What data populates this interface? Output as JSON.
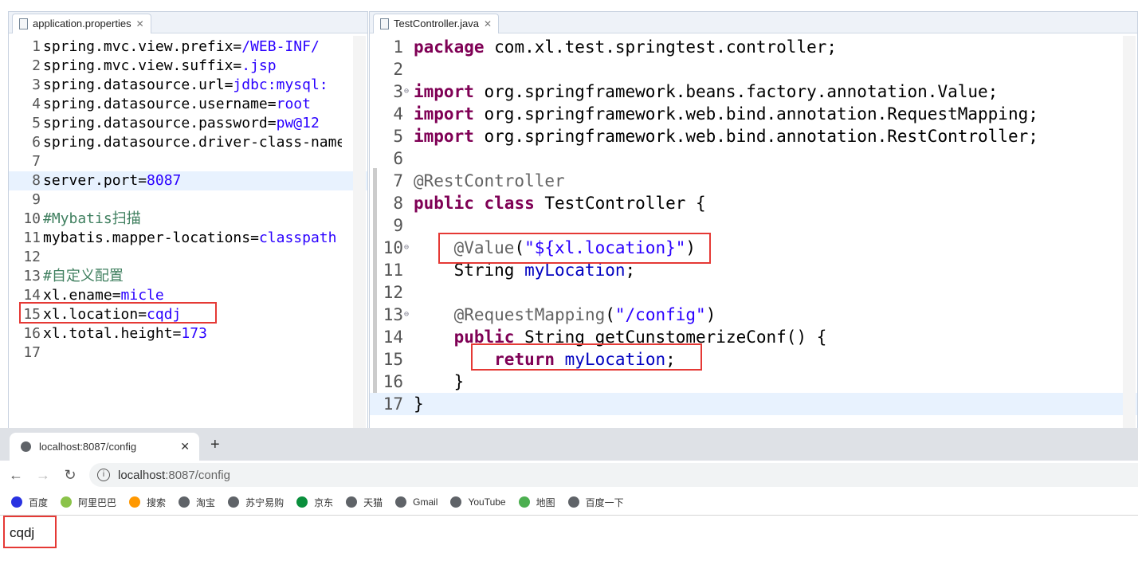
{
  "left_editor": {
    "tab": "application.properties",
    "lines": [
      [
        [
          "spring.mvc.view.prefix=",
          ""
        ],
        [
          "/WEB-INF/",
          "v"
        ]
      ],
      [
        [
          "spring.mvc.view.suffix=",
          ""
        ],
        [
          ".jsp",
          "v"
        ]
      ],
      [
        [
          "spring.datasource.url=",
          ""
        ],
        [
          "jdbc:mysql:",
          "v"
        ]
      ],
      [
        [
          "spring.datasource.username=",
          ""
        ],
        [
          "root",
          "v"
        ]
      ],
      [
        [
          "spring.datasource.password=",
          ""
        ],
        [
          "pw@12",
          "v"
        ]
      ],
      [
        [
          "spring.datasource.driver-class-name",
          ""
        ]
      ],
      [],
      [
        [
          "server.port=",
          ""
        ],
        [
          "8087",
          "v"
        ]
      ],
      [],
      [
        [
          "#Mybatis扫描",
          "c"
        ]
      ],
      [
        [
          "mybatis.mapper-locations=",
          ""
        ],
        [
          "classpath",
          "v"
        ]
      ],
      [],
      [
        [
          "#自定义配置",
          "c"
        ]
      ],
      [
        [
          "xl.ename=",
          ""
        ],
        [
          "micle",
          "v"
        ]
      ],
      [
        [
          "xl.location=",
          ""
        ],
        [
          "cqdj",
          "v"
        ]
      ],
      [
        [
          "xl.total.height=",
          ""
        ],
        [
          "173",
          "v"
        ]
      ],
      []
    ]
  },
  "right_editor": {
    "tab": "TestController.java",
    "lines": [
      [
        [
          "package",
          "k"
        ],
        [
          " com.xl.test.springtest.controller;",
          ""
        ]
      ],
      [],
      [
        [
          "import",
          "k"
        ],
        [
          " org.springframework.beans.factory.annotation.Value;",
          ""
        ]
      ],
      [
        [
          "import",
          "k"
        ],
        [
          " org.springframework.web.bind.annotation.RequestMapping;",
          ""
        ]
      ],
      [
        [
          "import",
          "k"
        ],
        [
          " org.springframework.web.bind.annotation.RestController;",
          ""
        ]
      ],
      [],
      [
        [
          "@RestController",
          "a"
        ]
      ],
      [
        [
          "public",
          "k"
        ],
        [
          " ",
          ""
        ],
        [
          "class",
          "k"
        ],
        [
          " TestController {",
          ""
        ]
      ],
      [],
      [
        [
          "    ",
          ""
        ],
        [
          "@Value",
          "a"
        ],
        [
          "(",
          ""
        ],
        [
          "\"${xl.location}\"",
          "s"
        ],
        [
          ")",
          ""
        ]
      ],
      [
        [
          "    String ",
          ""
        ],
        [
          "myLocation",
          "f"
        ],
        [
          ";",
          ""
        ]
      ],
      [],
      [
        [
          "    ",
          ""
        ],
        [
          "@RequestMapping",
          "a"
        ],
        [
          "(",
          ""
        ],
        [
          "\"/config\"",
          "s"
        ],
        [
          ")",
          ""
        ]
      ],
      [
        [
          "    ",
          ""
        ],
        [
          "public",
          "k"
        ],
        [
          " String getCunstomerizeConf() {",
          ""
        ]
      ],
      [
        [
          "        ",
          ""
        ],
        [
          "return",
          "k"
        ],
        [
          " ",
          ""
        ],
        [
          "myLocation",
          "f"
        ],
        [
          ";",
          ""
        ]
      ],
      [
        [
          "    }",
          ""
        ]
      ],
      [
        [
          "}",
          ""
        ]
      ]
    ]
  },
  "browser": {
    "tab_title": "localhost:8087/config",
    "url_host": "localhost",
    "url_rest": ":8087/config",
    "bookmarks": [
      "百度",
      "阿里巴巴",
      "搜索",
      "淘宝",
      "苏宁易购",
      "京东",
      "天猫",
      "Gmail",
      "YouTube",
      "地图",
      "百度一下"
    ],
    "page_text": "cqdj"
  },
  "colors": {
    "highlight_box": "#e53935",
    "keyword": "#7f0055",
    "string": "#2a00ff"
  }
}
